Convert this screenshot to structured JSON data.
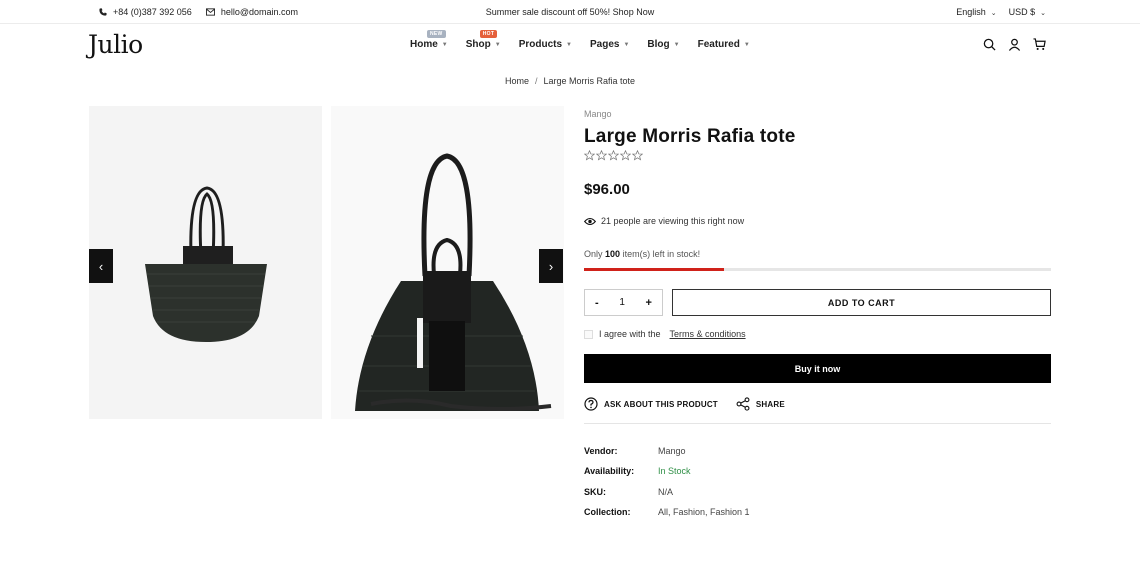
{
  "topbar": {
    "phone": "+84 (0)387 392 056",
    "email": "hello@domain.com",
    "promo": "Summer sale discount off 50%! Shop Now",
    "language": "English",
    "currency": "USD $"
  },
  "header": {
    "logo": "Julio",
    "nav": [
      {
        "label": "Home",
        "badge": "NEW"
      },
      {
        "label": "Shop",
        "badge": "HOT"
      },
      {
        "label": "Products"
      },
      {
        "label": "Pages"
      },
      {
        "label": "Blog"
      },
      {
        "label": "Featured"
      }
    ],
    "icons": [
      "search-icon",
      "user-icon",
      "cart-icon"
    ]
  },
  "breadcrumb": {
    "home": "Home",
    "separator": "/",
    "current": "Large Morris Rafia tote"
  },
  "product": {
    "vendor_label": "Mango",
    "title": "Large Morris Rafia tote",
    "rating": 0,
    "price": "$96.00",
    "viewing_text": "21 people are viewing this right now",
    "stock_prefix": "Only",
    "stock_count": "100",
    "stock_suffix": "item(s) left in stock!",
    "stock_fill_fraction": 0.3,
    "quantity": "1",
    "qty_minus": "-",
    "qty_plus": "+",
    "add_to_cart": "ADD TO CART",
    "agree_text": "I agree with the",
    "terms_link": "Terms & conditions",
    "buy_now": "Buy it now",
    "ask_label": "ASK ABOUT THIS PRODUCT",
    "share_label": "SHARE",
    "meta": [
      {
        "key": "Vendor:",
        "value": "Mango"
      },
      {
        "key": "Availability:",
        "value": "In Stock"
      },
      {
        "key": "SKU:",
        "value": "N/A"
      },
      {
        "key": "Collection:",
        "value": "All, Fashion, Fashion 1"
      }
    ]
  },
  "colors": {
    "accent": "#000000",
    "stock_bar": "#d0221a",
    "in_stock": "#2f8f46",
    "badge_new": "#a8b2c0",
    "badge_hot": "#e5603b"
  }
}
